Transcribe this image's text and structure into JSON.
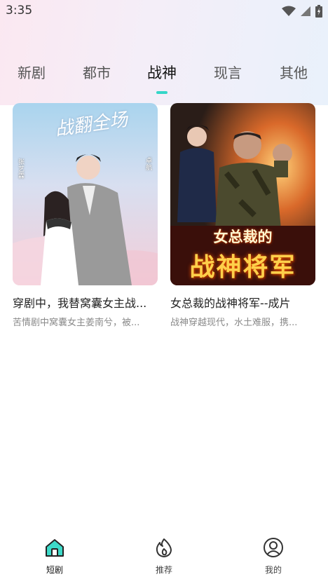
{
  "status_bar": {
    "time": "3:35"
  },
  "tabs": [
    {
      "label": "新剧",
      "active": false
    },
    {
      "label": "都市",
      "active": false
    },
    {
      "label": "战神",
      "active": true
    },
    {
      "label": "现言",
      "active": false
    },
    {
      "label": "其他",
      "active": false
    }
  ],
  "colors": {
    "accent": "#34d6c8"
  },
  "cards": [
    {
      "title": "穿剧中，我替窝囊女主战...",
      "description": "苦情剧中窝囊女主姜南兮，被...",
      "poster": {
        "headline": "战翻全场",
        "name_left": "张艺霖",
        "name_right": "卓航"
      }
    },
    {
      "title": "女总裁的战神将军--成片",
      "description": "战神穿越现代，水土难服，携...",
      "poster": {
        "headline_top": "女总裁的",
        "headline_main": "战神将军"
      }
    }
  ],
  "bottom_nav": [
    {
      "label": "短剧",
      "icon": "home-icon",
      "active": true
    },
    {
      "label": "推荐",
      "icon": "flame-icon",
      "active": false
    },
    {
      "label": "我的",
      "icon": "profile-icon",
      "active": false
    }
  ]
}
